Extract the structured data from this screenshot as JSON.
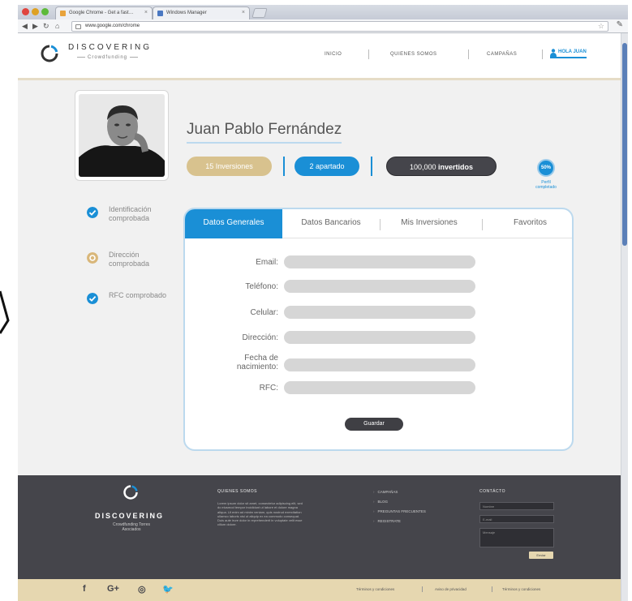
{
  "browser": {
    "tabs": [
      "Google Chrome - Get a fast…",
      "Windows Manager"
    ],
    "url": "www.google.com/chrome"
  },
  "site": {
    "brand_name": "DISCOVERING",
    "brand_sub": "Crowdfunding",
    "menu": [
      "INICIO",
      "QUIENES SOMOS",
      "CAMPAÑAS"
    ],
    "user_link": "HOLA JUAN"
  },
  "profile": {
    "name": "Juan Pablo Fernández",
    "pills": {
      "investments": "15 Inversiones",
      "reserved": "2 apartado",
      "invested_amount": "100,000",
      "invested_word": "invertidos"
    },
    "completion_percent": "50%",
    "completion_label": "Perfil completado",
    "verifications": [
      {
        "label": "Identificación comprobada",
        "status": "done"
      },
      {
        "label": "Dirección comprobada",
        "status": "pending"
      },
      {
        "label": "RFC comprobado",
        "status": "done"
      }
    ]
  },
  "tabs": [
    "Datos Generales",
    "Datos Bancarios",
    "Mis Inversiones",
    "Favoritos"
  ],
  "form": {
    "fields": [
      "Email:",
      "Teléfono:",
      "Celular:",
      "Dirección:",
      "Fecha de nacimiento:",
      "RFC:"
    ],
    "save_label": "Guardar"
  },
  "footer": {
    "brand": "DISCOVERING",
    "brand_sub": "Crowdfunding Torres Asociados",
    "about_title": "QUIENES SOMOS",
    "about_text": "Lorem ipsum dolor sit amet, consectetur adipiscing elit, sed do eiusmod tempor incididunt ut labore et dolore magna aliqua. Ut enim ad minim veniam, quis nostrud exercitation ullamco laboris nisi ut aliquip ex ea commodo consequat. Duis aute irure dolor in reprehenderit in voluptate velit esse cillum dolore.",
    "links": [
      "CAMPAÑAS",
      "BLOG",
      "PREGUNTAS FRECUENTES",
      "REGISTRATE"
    ],
    "contact_title": "CONTÁCTO",
    "contact_placeholders": [
      "Nombre",
      "E-mail",
      "Mensaje"
    ],
    "contact_submit": "Enviar",
    "social": [
      "f",
      "G+",
      "◎",
      "🐦"
    ],
    "legal": [
      "Términos y condiciones",
      "Aviso de privacidad",
      "Términos y condiciones"
    ]
  },
  "colors": {
    "accent_blue": "#1a8fd6",
    "gold": "#d8c28e",
    "dark": "#45454b",
    "pending": "#d9b77a"
  }
}
